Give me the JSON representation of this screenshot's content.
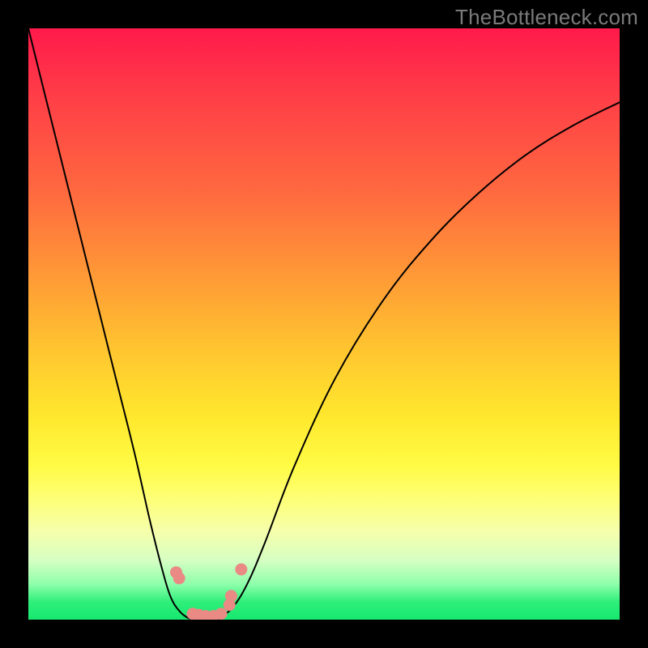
{
  "watermark": {
    "text": "TheBottleneck.com"
  },
  "chart_data": {
    "type": "line",
    "title": "",
    "xlabel": "",
    "ylabel": "",
    "xlim": [
      0,
      1
    ],
    "ylim": [
      0,
      1
    ],
    "series": [
      {
        "name": "left-branch",
        "x": [
          0.0,
          0.03,
          0.06,
          0.09,
          0.12,
          0.15,
          0.18,
          0.205,
          0.225,
          0.24,
          0.255,
          0.27,
          0.285
        ],
        "y": [
          1.0,
          0.88,
          0.76,
          0.64,
          0.52,
          0.4,
          0.28,
          0.17,
          0.09,
          0.04,
          0.015,
          0.003,
          0.0
        ]
      },
      {
        "name": "right-branch",
        "x": [
          0.32,
          0.345,
          0.37,
          0.4,
          0.45,
          0.52,
          0.6,
          0.68,
          0.76,
          0.84,
          0.92,
          1.0
        ],
        "y": [
          0.0,
          0.02,
          0.06,
          0.13,
          0.26,
          0.41,
          0.54,
          0.64,
          0.72,
          0.785,
          0.835,
          0.875
        ]
      }
    ],
    "markers": {
      "name": "highlight-dots",
      "color": "#e98a85",
      "points": [
        {
          "x": 0.25,
          "y": 0.08
        },
        {
          "x": 0.255,
          "y": 0.07
        },
        {
          "x": 0.278,
          "y": 0.01
        },
        {
          "x": 0.288,
          "y": 0.008
        },
        {
          "x": 0.3,
          "y": 0.006
        },
        {
          "x": 0.313,
          "y": 0.006
        },
        {
          "x": 0.326,
          "y": 0.01
        },
        {
          "x": 0.34,
          "y": 0.025
        },
        {
          "x": 0.343,
          "y": 0.04
        },
        {
          "x": 0.36,
          "y": 0.085
        }
      ]
    }
  }
}
